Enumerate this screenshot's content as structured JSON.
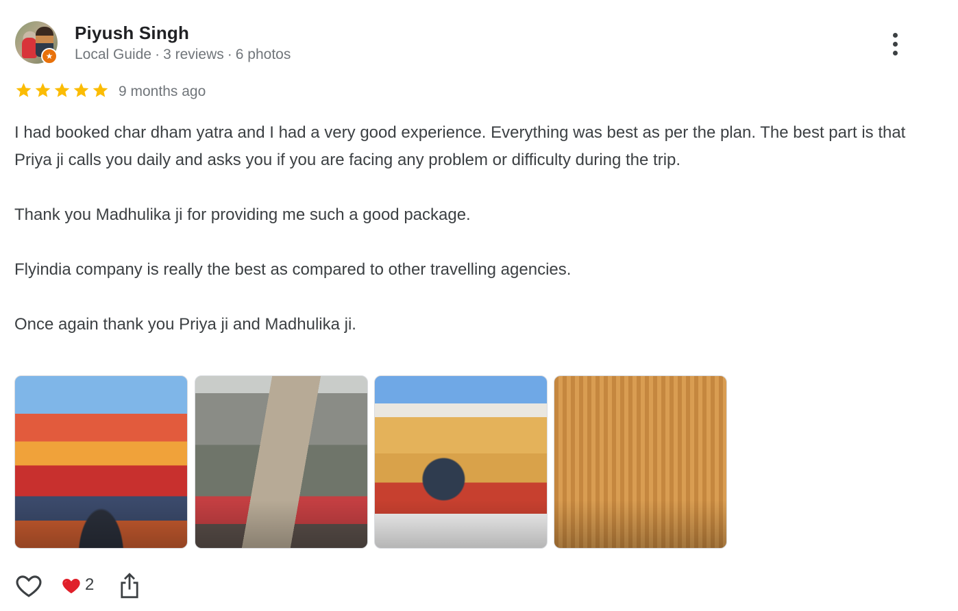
{
  "author": {
    "name": "Piyush Singh",
    "role": "Local Guide",
    "reviews": "3 reviews",
    "photos": "6 photos",
    "separator": "·"
  },
  "rating": {
    "stars": 5,
    "max": 5,
    "time_ago": "9 months ago",
    "star_color": "#fbbc04"
  },
  "review": {
    "paragraphs": [
      "I had booked char dham yatra and I had a very good experience. Everything was best as per the plan. The best part is that Priya ji calls you daily and asks you if you are facing any problem or difficulty during the trip.",
      "Thank you Madhulika ji for providing me such a good package.",
      "Flyindia company is really the best as compared to other travelling agencies.",
      "Once again thank you Priya ji and Madhulika ji."
    ]
  },
  "photos": [
    {
      "name": "badrinath-temple-photo"
    },
    {
      "name": "kedarnath-temple-photo"
    },
    {
      "name": "gangotri-temple-photo"
    },
    {
      "name": "yamunotri-temple-photo"
    }
  ],
  "actions": {
    "like_icon": "heart-outline-icon",
    "reaction_icon": "red-heart-icon",
    "reaction_count": "2",
    "share_icon": "share-icon",
    "more_icon": "more-vertical-icon"
  },
  "colors": {
    "badge": "#e8710a",
    "text": "#3c4043",
    "meta": "#70757a"
  }
}
